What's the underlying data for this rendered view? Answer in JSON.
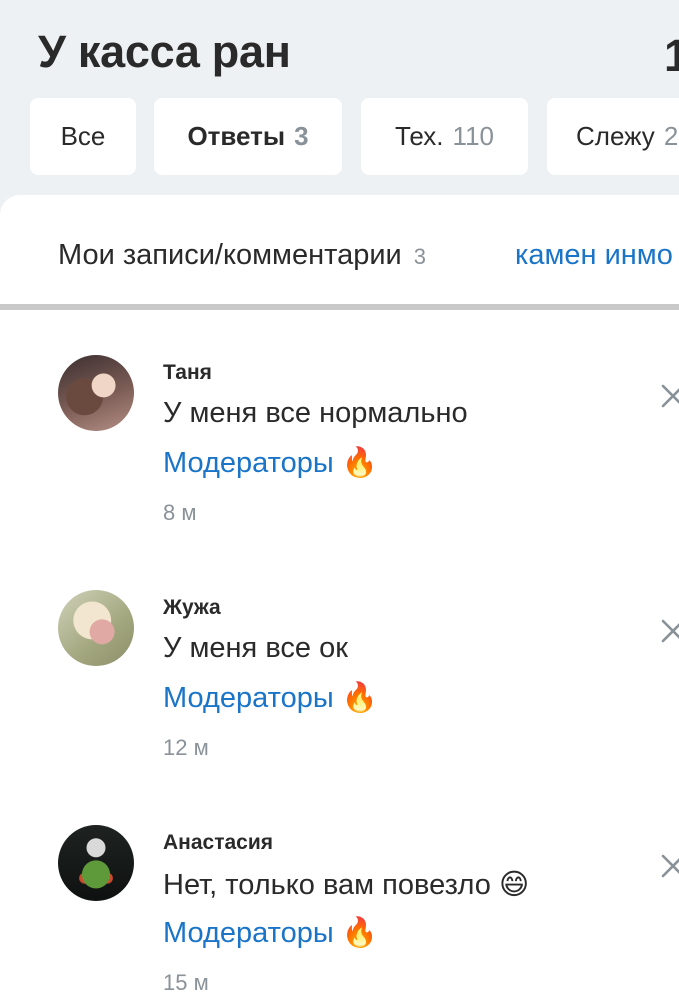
{
  "header": {
    "title": "У касса ран",
    "title_overflow": "1"
  },
  "tabs": [
    {
      "label": "Все",
      "count": ""
    },
    {
      "label": "Ответы",
      "count": "3"
    },
    {
      "label": "Тех.",
      "count": "110"
    },
    {
      "label": "Слежу",
      "count": "2"
    }
  ],
  "subtabs": {
    "main_label": "Мои записи/комментарии",
    "main_count": "3",
    "second_label": "камен инмо"
  },
  "notifications": [
    {
      "name": "Таня",
      "text": "У меня все нормально",
      "group": "Модераторы",
      "emoji": "🔥",
      "time": "8 м"
    },
    {
      "name": "Жужа",
      "text": "У меня все ок",
      "group": "Модераторы",
      "emoji": "🔥",
      "time": "12 м"
    },
    {
      "name": "Анастасия",
      "text": "Нет, только вам повезло 😄",
      "group": "Модераторы",
      "emoji": "🔥",
      "time": "15 м"
    }
  ],
  "icons": {
    "dismiss": "close-icon",
    "fire": "fire-emoji"
  },
  "colors": {
    "link": "#1a74c7",
    "muted": "#8a9299",
    "background": "#edf1f3"
  }
}
